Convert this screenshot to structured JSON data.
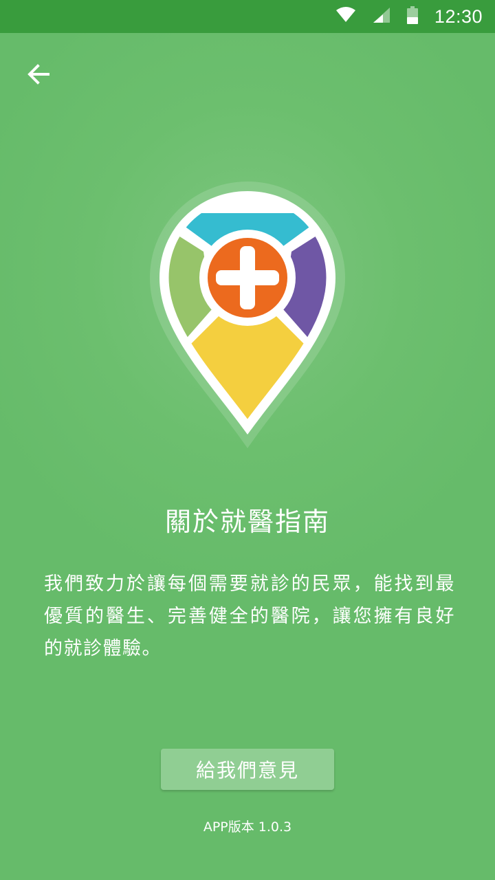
{
  "status_bar": {
    "time": "12:30",
    "icons": [
      "wifi-icon",
      "signal-icon",
      "battery-icon"
    ],
    "background": "#399c3d"
  },
  "header": {
    "back_icon": "back-arrow-icon"
  },
  "logo": {
    "icon": "map-pin-medical-cross-logo",
    "colors": {
      "top": "#35bcd0",
      "left": "#97c46a",
      "right": "#6f57a5",
      "bottom": "#f4cf3f",
      "center": "#ec6a1e",
      "outline": "#ffffff"
    }
  },
  "main": {
    "title": "關於就醫指南",
    "description": "我們致力於讓每個需要就診的民眾，能找到最優質的醫生、完善健全的醫院，讓您擁有良好的就診體驗。",
    "feedback_button": "給我們意見",
    "version": "APP版本 1.0.3"
  },
  "theme": {
    "background": "#66bb6a",
    "text": "#ffffff"
  }
}
